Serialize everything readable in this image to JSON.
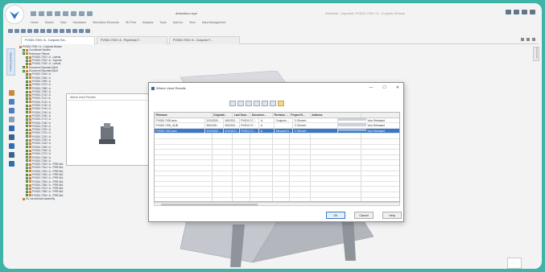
{
  "app": {
    "file_title": "defaultdoc.txpe",
    "app_title": "Windchill - Imported: PV0D0-7000 / A - Conjunto Bolsas",
    "menu": [
      "Home",
      "Sketch",
      "View",
      "Simulation",
      "Simulation Elements",
      "3D Print",
      "Analysis",
      "Tools",
      "Add-Ins",
      "View",
      "Data Management"
    ]
  },
  "tabs": [
    {
      "label": "PV0D0-7000 / A - Conjunto Sol...",
      "active": true
    },
    {
      "label": "PV0D0-7000 / A - Pepelinda T...",
      "active": false
    },
    {
      "label": "PV0D0-7000 / A - Conjunto F...",
      "active": false
    }
  ],
  "rail": {
    "top_label": "Windchill Explorer",
    "right_label": "Properties"
  },
  "tree": {
    "items": [
      {
        "label": "PV0D0-7000 / A - Conjunto Bolsas",
        "level": 0,
        "checkbox": false
      },
      {
        "label": "Coordinate System",
        "level": 1,
        "checkbox": true
      },
      {
        "label": "Reference Planes",
        "level": 1,
        "checkbox": true
      },
      {
        "label": "PV0D0-7010 / A - Lateral",
        "level": 2,
        "checkbox": true
      },
      {
        "label": "PV0D0-7020 / A - Soporte",
        "level": 2,
        "checkbox": true
      },
      {
        "label": "PV0D0-7030 / A - Lateral",
        "level": 2,
        "checkbox": true
      },
      {
        "label": "Document Standard (Bolt",
        "level": 1,
        "checkbox": true
      },
      {
        "label": "Document Standard (Bolt",
        "level": 1,
        "checkbox": true
      },
      {
        "label": "PV0D0-7040 / A",
        "level": 2,
        "checkbox": true
      },
      {
        "label": "PV0D0-7050 / A",
        "level": 2,
        "checkbox": true
      },
      {
        "label": "PV0D0-7060 / A",
        "level": 2,
        "checkbox": true
      },
      {
        "label": "PV0D0-7070 / A",
        "level": 2,
        "checkbox": true
      },
      {
        "label": "PV0D0-7080 / A",
        "level": 2,
        "checkbox": true
      },
      {
        "label": "PV0D0-7090 / A",
        "level": 2,
        "checkbox": true
      },
      {
        "label": "PV0D0-7100 / A",
        "level": 2,
        "checkbox": true
      },
      {
        "label": "PV0D0-7110 / A",
        "level": 2,
        "checkbox": true
      },
      {
        "label": "PV0D0-7120 / A",
        "level": 2,
        "checkbox": true
      },
      {
        "label": "PV0D0-7130 / A",
        "level": 2,
        "checkbox": true
      },
      {
        "label": "PV0D0-7140 / A",
        "level": 2,
        "checkbox": true
      },
      {
        "label": "PV0D0-7150 / A",
        "level": 2,
        "checkbox": true
      },
      {
        "label": "PV0D0-7160 / A",
        "level": 2,
        "checkbox": true
      },
      {
        "label": "PV0D0-7170 / A",
        "level": 2,
        "checkbox": true
      },
      {
        "label": "PV0D0-7180 / A",
        "level": 2,
        "checkbox": true
      },
      {
        "label": "PV0D0-7190 / A",
        "level": 2,
        "checkbox": true
      },
      {
        "label": "PV0D0-7200 / A",
        "level": 2,
        "checkbox": true
      },
      {
        "label": "PV0D0-7210 / A",
        "level": 2,
        "checkbox": true
      },
      {
        "label": "PV0D0-7220 / A",
        "level": 2,
        "checkbox": true
      },
      {
        "label": "PV0D0-7230 / A",
        "level": 2,
        "checkbox": true
      },
      {
        "label": "PV0D0-7240 / A",
        "level": 2,
        "checkbox": true
      },
      {
        "label": "PV0D0-7250 / A",
        "level": 2,
        "checkbox": true
      },
      {
        "label": "PV0D0-7260 / A",
        "level": 2,
        "checkbox": true
      },
      {
        "label": "PV0D0-7270 / A",
        "level": 2,
        "checkbox": true
      },
      {
        "label": "PV0D0-7280 / A",
        "level": 2,
        "checkbox": true
      },
      {
        "label": "PV0D0-7290 / A",
        "level": 2,
        "checkbox": true
      },
      {
        "label": "PV0D0-7300 / A - PRR-WA",
        "level": 2,
        "checkbox": true
      },
      {
        "label": "PV0D0-7310 / A - PRR-WA",
        "level": 2,
        "checkbox": true
      },
      {
        "label": "PV0D0-7320 / A - PRR-WA",
        "level": 2,
        "checkbox": true
      },
      {
        "label": "PV0D0-7330 / A - PRR-WA",
        "level": 2,
        "checkbox": true
      },
      {
        "label": "PV0D0-7340 / A - PRR-WA",
        "level": 2,
        "checkbox": true
      },
      {
        "label": "PV0D0-7350 / A - PRR-WA",
        "level": 2,
        "checkbox": true
      },
      {
        "label": "PV0D0-7360 / A - PRR-WA",
        "level": 2,
        "checkbox": true
      },
      {
        "label": "PV0D0-7370 / A - PRR-WA",
        "level": 2,
        "checkbox": true
      },
      {
        "label": "PV0D0-7380 / A - PRR-WA",
        "level": 2,
        "checkbox": true
      },
      {
        "label": "PV0D0-7390 / A - PRR-WA",
        "level": 2,
        "checkbox": true
      },
      {
        "label": "Do not add add assembly",
        "level": 1,
        "checkbox": false
      }
    ]
  },
  "preview": {
    "title": "Where Used Preview"
  },
  "dialog": {
    "title": "Where Used Results",
    "minimize": "—",
    "maximize": "☐",
    "close": "✕",
    "columns": [
      "Filename",
      "Originati...",
      "Last Save...",
      "Documen...",
      "Revision ...",
      "Project N...",
      "Address",
      ""
    ],
    "rows": [
      {
        "cells": [
          "PV0D0-7000.asm",
          "2/20/2020...",
          "5/6/2021 ...",
          "PV0D0-7C...",
          "A",
          "Conjunto ...",
          "C:\\Server\\",
          "Vme Released"
        ],
        "selected": false
      },
      {
        "cells": [
          "PV0D0-7000_SUB",
          "5/6/2020...",
          "5/6/2021 ...",
          "PV0D0-7C...",
          "A",
          "",
          "C:\\Server\\",
          "Vme Released"
        ],
        "selected": false
      },
      {
        "cells": [
          "PV0D0-7001.asm",
          "2/20/2020...",
          "6/10/2021 ...",
          "PV0D0-7C...",
          "A",
          "Elevador B...",
          "C:\\Server\\",
          "Vme Released"
        ],
        "selected": true
      }
    ],
    "buttons": {
      "ok": "OK",
      "cancel": "Cancel",
      "help": "Help"
    }
  },
  "colors": {
    "frame": "#3fb3a8",
    "accent": "#3b79c8",
    "folder": "#c8873a"
  }
}
